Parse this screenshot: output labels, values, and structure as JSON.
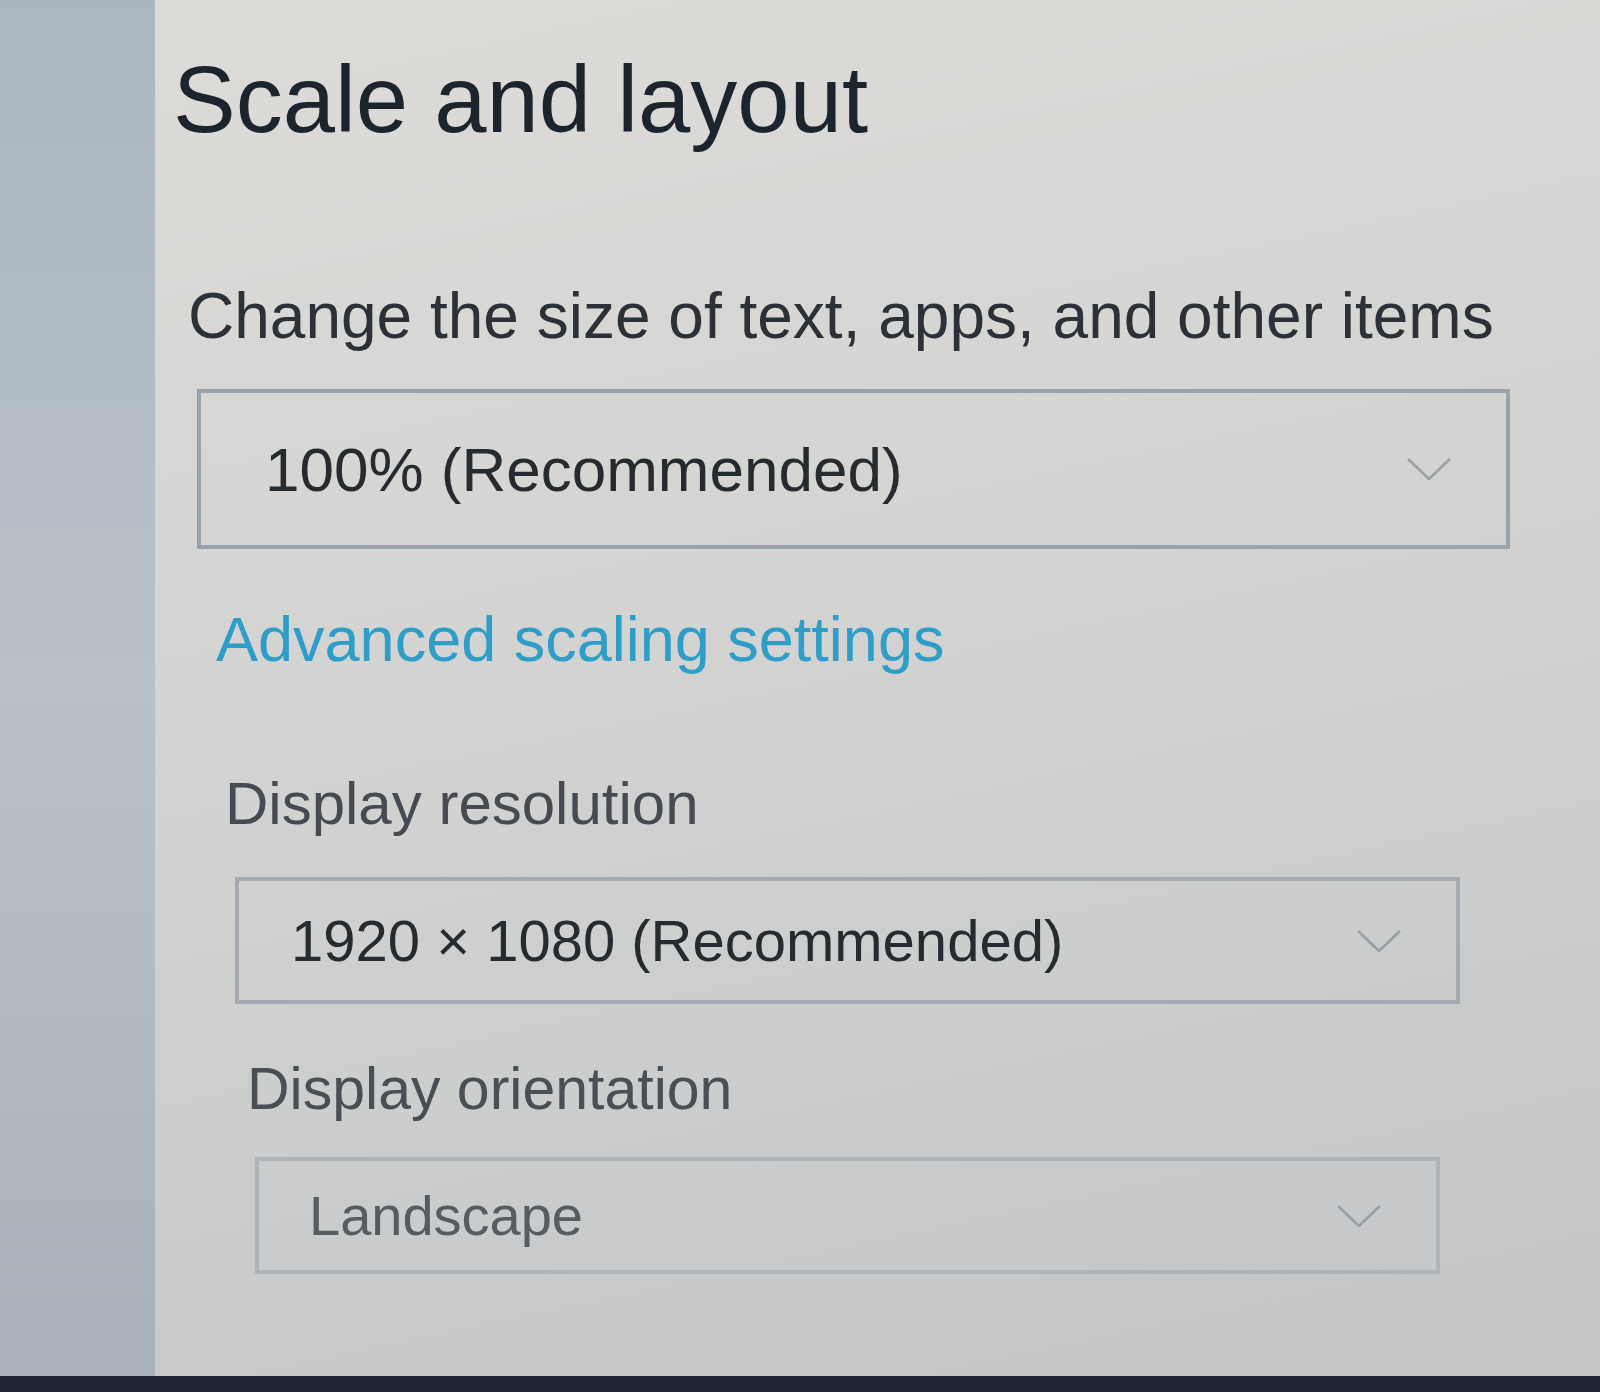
{
  "page": {
    "title": "Scale and layout"
  },
  "settings": [
    {
      "kind": "dropdown",
      "label": "Change the size of text, apps, and other items",
      "value": "100% (Recommended)"
    },
    {
      "kind": "link",
      "text": "Advanced scaling settings"
    },
    {
      "kind": "dropdown",
      "label": "Display resolution",
      "value": "1920 × 1080 (Recommended)"
    },
    {
      "kind": "dropdown",
      "label": "Display orientation",
      "value": "Landscape"
    }
  ]
}
